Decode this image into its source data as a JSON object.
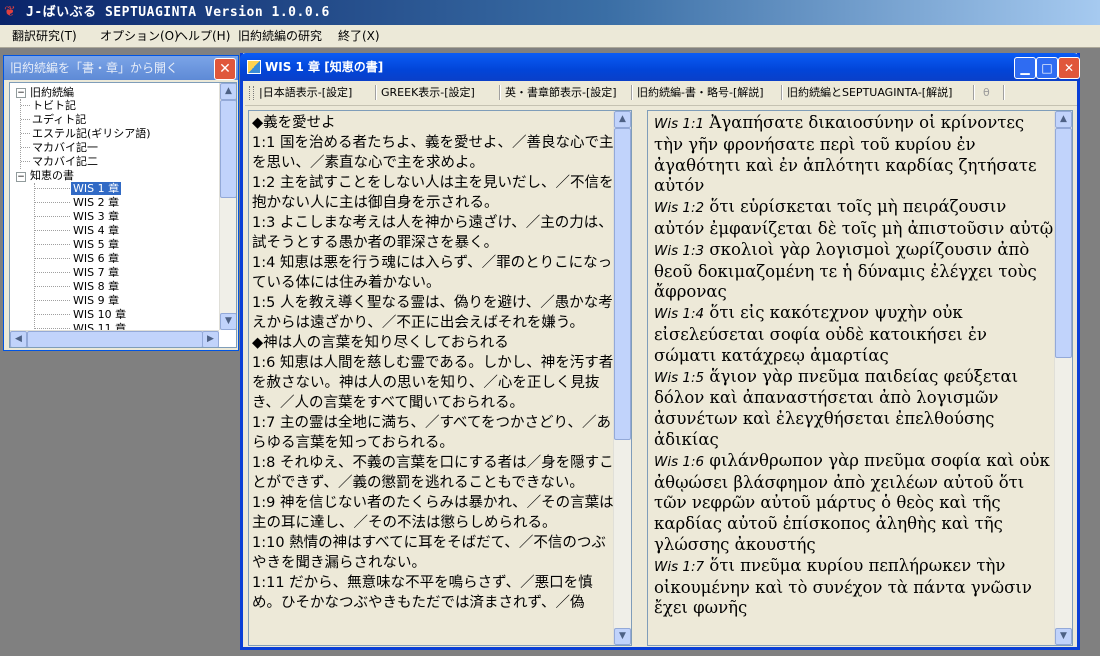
{
  "app": {
    "title": "J-ばいぶる  SEPTUAGINTA Version 1.0.0.6",
    "logo_icon": "app-logo-icon"
  },
  "menu": [
    {
      "label": "翻訳研究(T)"
    },
    {
      "label": "オプション(O)"
    },
    {
      "label": "ヘルプ(H)"
    },
    {
      "label": "旧約続編の研究"
    },
    {
      "label": "終了(X)"
    }
  ],
  "tree_panel": {
    "title": "旧約続編を「書・章」から開く",
    "close_glyph": "✕",
    "root_label": "旧約続編",
    "books": [
      "トビト記",
      "ユディト記",
      "エステル記(ギリシア語)",
      "マカバイ記一",
      "マカバイ記二"
    ],
    "open_book": "知恵の書",
    "chapters": [
      "WIS 1 章",
      "WIS 2 章",
      "WIS 3 章",
      "WIS 4 章",
      "WIS 5 章",
      "WIS 6 章",
      "WIS 7 章",
      "WIS 8 章",
      "WIS 9 章",
      "WIS 10 章",
      "WIS 11 章"
    ],
    "selected_chapter": "WIS 1 章"
  },
  "chapter_window": {
    "title": "WIS 1 章 [知恵の書]",
    "toolbar": [
      "日本語表示-[設定]",
      "GREEK表示-[設定]",
      "英・書章節表示-[設定]",
      "旧約続編-書・略号-[解説]",
      "旧約続編とSEPTUAGINTA-[解説]",
      "θ"
    ]
  },
  "japanese_text": [
    "◆義を愛せよ",
    "1:1 国を治める者たちよ、義を愛せよ、／善良な心で主を思い、／素直な心で主を求めよ。",
    "1:2 主を試すことをしない人は主を見いだし、／不信を抱かない人に主は御自身を示される。",
    "1:3 よこしまな考えは人を神から遠ざけ、／主の力は、試そうとする愚か者の罪深さを暴く。",
    "1:4 知恵は悪を行う魂には入らず、／罪のとりこになっている体には住み着かない。",
    "1:5 人を教え導く聖なる霊は、偽りを避け、／愚かな考えからは遠ざかり、／不正に出会えばそれを嫌う。",
    "◆神は人の言葉を知り尽くしておられる",
    "1:6 知恵は人間を慈しむ霊である。しかし、神を汚す者を赦さない。神は人の思いを知り、／心を正しく見抜き、／人の言葉をすべて聞いておられる。",
    "1:7 主の霊は全地に満ち、／すべてをつかさどり、／あらゆる言葉を知っておられる。",
    "1:8 それゆえ、不義の言葉を口にする者は／身を隠すことができず、／義の懲罰を逃れることもできない。",
    "1:9 神を信じない者のたくらみは暴かれ、／その言葉は主の耳に達し、／その不法は懲らしめられる。",
    "1:10 熱情の神はすべてに耳をそばだて、／不信のつぶやきを聞き漏らされない。",
    "1:11 だから、無意味な不平を鳴らさず、／悪口を慎め。ひそかなつぶやきもただでは済まされず、／偽"
  ],
  "greek_text": [
    {
      "ref": "Wis 1:1",
      "text": "Ἀγαπήσατε δικαιοσύνην οἱ κρίνοντες τὴν γῆν φρονήσατε περὶ τοῦ κυρίου ἐν ἀγαθότητι καὶ ἐν ἁπλότητι καρδίας ζητήσατε αὐτόν"
    },
    {
      "ref": "Wis 1:2",
      "text": "ὅτι εὑρίσκεται τοῖς μὴ πειράζουσιν αὐτόν ἐμφανίζεται δὲ τοῖς μὴ ἀπιστοῦσιν αὐτῷ"
    },
    {
      "ref": "Wis 1:3",
      "text": "σκολιοὶ γὰρ λογισμοὶ χωρίζουσιν ἀπὸ θεοῦ δοκιμαζομένη τε ἡ δύναμις ἐλέγχει τοὺς ἄφρονας"
    },
    {
      "ref": "Wis 1:4",
      "text": "ὅτι εἰς κακότεχνον ψυχὴν οὐκ εἰσελεύσεται σοφία οὐδὲ κατοικήσει ἐν σώματι κατάχρεῳ ἁμαρτίας"
    },
    {
      "ref": "Wis 1:5",
      "text": "ἅγιον γὰρ πνεῦμα παιδείας φεύξεται δόλον καὶ ἀπαναστήσεται ἀπὸ λογισμῶν ἀσυνέτων καὶ ἐλεγχθήσεται ἐπελθούσης ἀδικίας"
    },
    {
      "ref": "Wis 1:6",
      "text": "φιλάνθρωπον γὰρ πνεῦμα σοφία καὶ οὐκ ἀθῳώσει βλάσφημον ἀπὸ χειλέων αὐτοῦ ὅτι τῶν νεφρῶν αὐτοῦ μάρτυς ὁ θεὸς καὶ τῆς καρδίας αὐτοῦ ἐπίσκοπος ἀληθὴς καὶ τῆς γλώσσης ἀκουστής"
    },
    {
      "ref": "Wis 1:7",
      "text": "ὅτι πνεῦμα κυρίου πεπλήρωκεν τὴν οἰκουμένην καὶ τὸ συνέχον τὰ πάντα γνῶσιν ἔχει φωνῆς"
    }
  ]
}
